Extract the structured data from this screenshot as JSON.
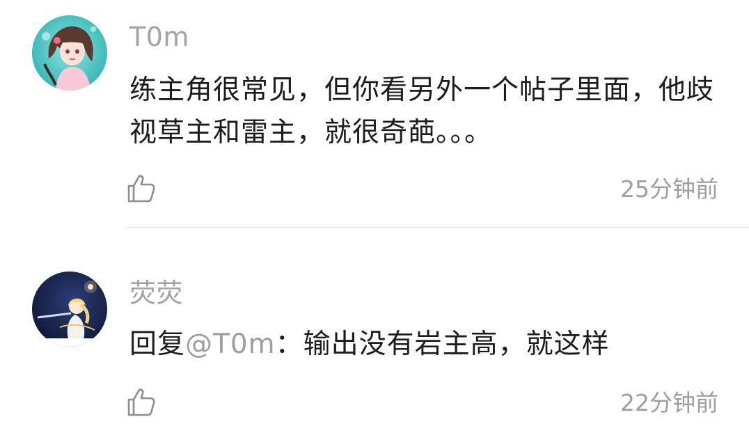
{
  "comments": [
    {
      "username": "T0m",
      "text": "练主角很常见，但你看另外一个帖子里面，他歧视草主和雷主，就很奇葩。。。",
      "time": "25分钟前",
      "avatar_icon": "anime-girl-avatar",
      "like_icon": "thumbs-up-icon"
    },
    {
      "username": "荧荧",
      "reply_prefix": "回复",
      "mention": "@T0m",
      "reply_text": "：输出没有岩主高，就这样",
      "time": "22分钟前",
      "avatar_icon": "traveler-lumine-avatar",
      "like_icon": "thumbs-up-icon"
    }
  ],
  "colors": {
    "text": "#1c1c1c",
    "meta": "#9e9e9e",
    "divider": "#ececec"
  }
}
